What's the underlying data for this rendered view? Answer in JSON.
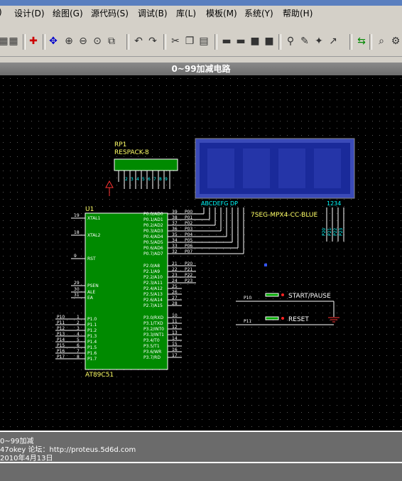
{
  "menu": {
    "items": [
      "设计(D)",
      "绘图(G)",
      "源代码(S)",
      "调试(B)",
      "库(L)",
      "模板(M)",
      "系统(Y)",
      "帮助(H)"
    ]
  },
  "document": {
    "title": "0~99加减电路"
  },
  "schematic": {
    "rp1": {
      "ref": "RP1",
      "value": "RESPACK-8",
      "pins": [
        "2",
        "3",
        "4",
        "5",
        "6",
        "7",
        "8",
        "9"
      ]
    },
    "display": {
      "part": "7SEG-MPX4-CC-BLUE",
      "seg_labels": "ABCDEFG DP",
      "digit_labels": "1234",
      "digit_nets": [
        "P20",
        "P21",
        "P22",
        "P23"
      ]
    },
    "u1": {
      "ref": "U1",
      "part": "AT89C51",
      "left_pins": [
        {
          "num": "19",
          "name": "XTAL1"
        },
        {
          "num": "18",
          "name": "XTAL2"
        },
        {
          "num": "9",
          "name": "RST"
        },
        {
          "num": "29",
          "name": "PSEN"
        },
        {
          "num": "30",
          "name": "ALE"
        },
        {
          "num": "31",
          "name": "EA"
        }
      ],
      "p0_pins": [
        {
          "num": "39",
          "name": "P0.0/AD0",
          "net": "P00"
        },
        {
          "num": "38",
          "name": "P0.1/AD1",
          "net": "P01"
        },
        {
          "num": "37",
          "name": "P0.2/AD2",
          "net": "P02"
        },
        {
          "num": "36",
          "name": "P0.3/AD3",
          "net": "P03"
        },
        {
          "num": "35",
          "name": "P0.4/AD4",
          "net": "P04"
        },
        {
          "num": "34",
          "name": "P0.5/AD5",
          "net": "P05"
        },
        {
          "num": "33",
          "name": "P0.6/AD6",
          "net": "P06"
        },
        {
          "num": "32",
          "name": "P0.7/AD7",
          "net": "P07"
        }
      ],
      "p2_pins": [
        {
          "num": "21",
          "name": "P2.0/A8",
          "net": "P20"
        },
        {
          "num": "22",
          "name": "P2.1/A9",
          "net": "P21"
        },
        {
          "num": "23",
          "name": "P2.2/A10",
          "net": "P22"
        },
        {
          "num": "24",
          "name": "P2.3/A11",
          "net": "P23"
        },
        {
          "num": "25",
          "name": "P2.4/A12",
          "net": ""
        },
        {
          "num": "26",
          "name": "P2.5/A13",
          "net": ""
        },
        {
          "num": "27",
          "name": "P2.6/A14",
          "net": ""
        },
        {
          "num": "28",
          "name": "P2.7/A15",
          "net": ""
        }
      ],
      "p3_pins": [
        {
          "num": "10",
          "name": "P3.0/RXD"
        },
        {
          "num": "11",
          "name": "P3.1/TXD"
        },
        {
          "num": "12",
          "name": "P3.2/INT0"
        },
        {
          "num": "13",
          "name": "P3.3/INT1"
        },
        {
          "num": "14",
          "name": "P3.4/T0"
        },
        {
          "num": "15",
          "name": "P3.5/T1"
        },
        {
          "num": "16",
          "name": "P3.6/WR"
        },
        {
          "num": "17",
          "name": "P3.7/RD"
        }
      ],
      "p1_pins": [
        {
          "num": "1",
          "name": "P1.0",
          "net": "P10"
        },
        {
          "num": "2",
          "name": "P1.1",
          "net": "P11"
        },
        {
          "num": "3",
          "name": "P1.2",
          "net": "P12"
        },
        {
          "num": "4",
          "name": "P1.3",
          "net": "P13"
        },
        {
          "num": "5",
          "name": "P1.4",
          "net": "P14"
        },
        {
          "num": "6",
          "name": "P1.5",
          "net": "P15"
        },
        {
          "num": "7",
          "name": "P1.6",
          "net": "P16"
        },
        {
          "num": "8",
          "name": "P1.7",
          "net": "P17"
        }
      ]
    },
    "buttons": [
      {
        "net": "P10",
        "label": "START/PAUSE"
      },
      {
        "net": "P11",
        "label": "RESET"
      }
    ]
  },
  "footer": {
    "lines": [
      "0~99加减",
      "47okey      论坛：http://proteus.5d6d.com",
      "2010年4月13日"
    ]
  },
  "colors": {
    "canvas": "#000000",
    "chip": "#008a00",
    "wire": "#ffffff",
    "label": "#ffff00",
    "pin": "#00ffff",
    "display": "#1a2a9a"
  }
}
